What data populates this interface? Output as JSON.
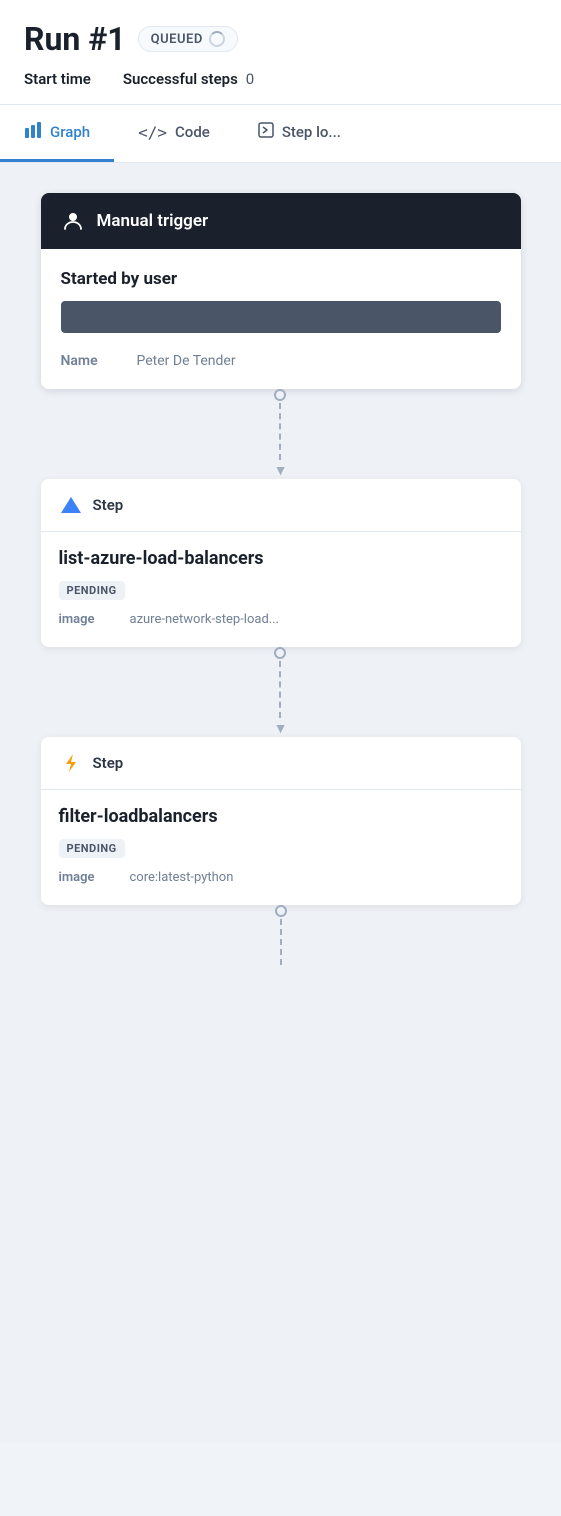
{
  "header": {
    "run_title": "Run #1",
    "status_badge": "QUEUED",
    "start_time_label": "Start time",
    "start_time_value": "",
    "successful_steps_label": "Successful steps",
    "successful_steps_value": "0"
  },
  "tabs": [
    {
      "id": "graph",
      "label": "Graph",
      "icon": "graph-icon",
      "active": true
    },
    {
      "id": "code",
      "label": "Code",
      "icon": "code-icon",
      "active": false
    },
    {
      "id": "step-log",
      "label": "Step lo...",
      "icon": "step-log-icon",
      "active": false
    }
  ],
  "manual_trigger": {
    "header_label": "Manual trigger",
    "started_by_label": "Started by user",
    "name_label": "Name",
    "name_value": "Peter De Tender"
  },
  "steps": [
    {
      "id": "step1",
      "header_label": "Step",
      "icon": "triangle-icon",
      "name": "list-azure-load-balancers",
      "status": "PENDING",
      "image_label": "image",
      "image_value": "azure-network-step-load..."
    },
    {
      "id": "step2",
      "header_label": "Step",
      "icon": "bolt-icon",
      "name": "filter-loadbalancers",
      "status": "PENDING",
      "image_label": "image",
      "image_value": "core:latest-python"
    }
  ],
  "colors": {
    "active_tab": "#3182ce",
    "triangle_icon": "#3b82f6",
    "bolt_icon": "#f59e0b"
  }
}
